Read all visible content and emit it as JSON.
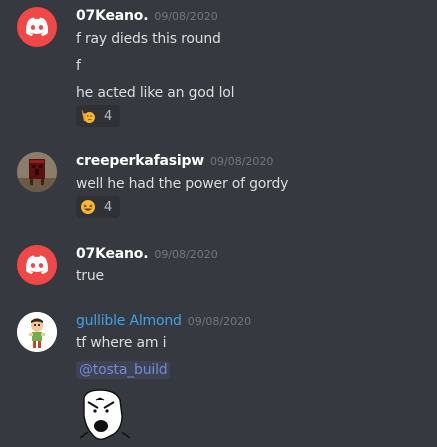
{
  "messages": [
    {
      "username": "07Keano.",
      "timestamp": "09/08/2020",
      "lines": [
        "f ray dieds this round",
        "f",
        "he acted like an god lol"
      ],
      "reaction": {
        "emoji": "thinking-hand-icon",
        "count": "4"
      }
    },
    {
      "username": "creeperkafasipw",
      "timestamp": "09/08/2020",
      "lines": [
        "well he had the power of gordy"
      ],
      "reaction": {
        "emoji": "laughing-face-icon",
        "count": "4"
      }
    },
    {
      "username": "07Keano.",
      "timestamp": "09/08/2020",
      "lines": [
        "true"
      ]
    },
    {
      "username": "gullible Almond",
      "timestamp": "09/08/2020",
      "lines": [
        "tf where am i"
      ],
      "mention": "@tosta_build",
      "image": "y-u-no-meme-face"
    }
  ],
  "colors": {
    "background": "#36393f",
    "discord_avatar": "#f04747",
    "username_highlight": "#3ea3e6",
    "mention": "#7289da"
  }
}
